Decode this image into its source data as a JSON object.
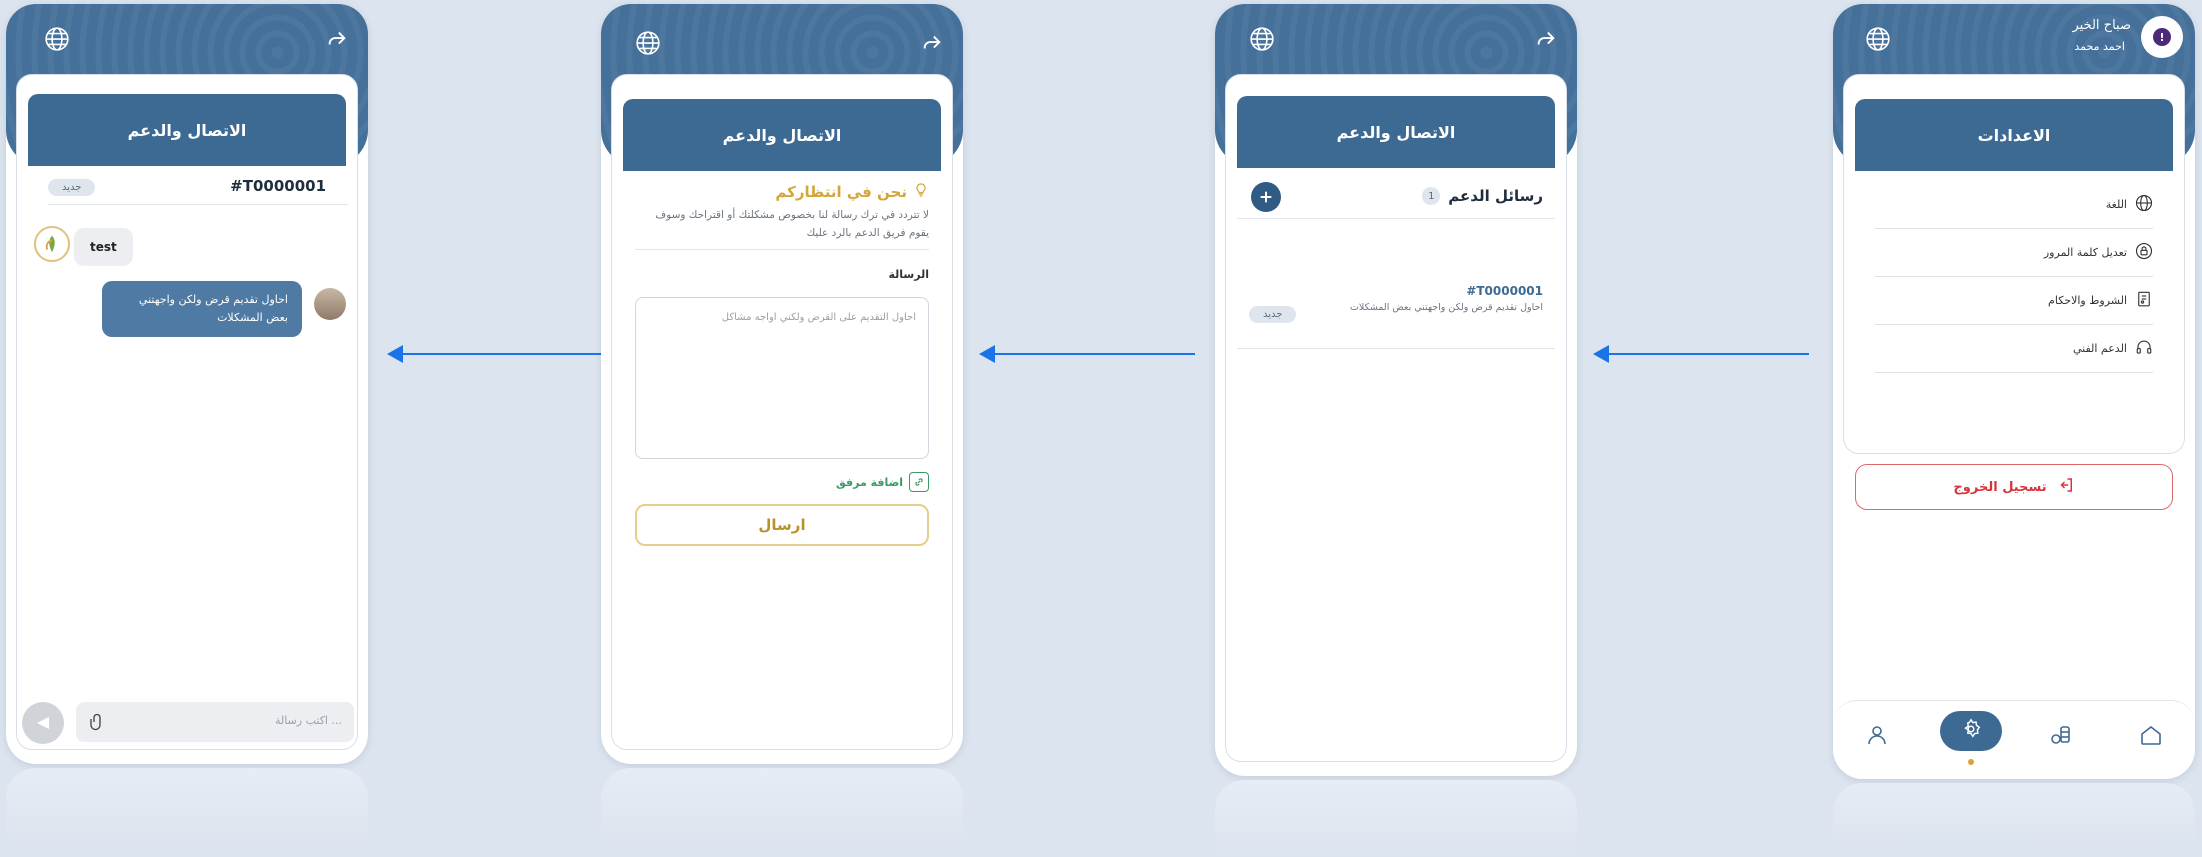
{
  "screens": {
    "settings": {
      "greeting": "صباح الخير",
      "user_name": "احمد محمد",
      "title": "الاعدادات",
      "items": [
        {
          "label": "اللغة",
          "icon": "globe-icon"
        },
        {
          "label": "تعديل كلمة المرور",
          "icon": "lock-icon"
        },
        {
          "label": "الشروط والاحكام",
          "icon": "document-icon"
        },
        {
          "label": "الدعم الفني",
          "icon": "headset-icon"
        }
      ],
      "logout_label": "تسجيل الخروج",
      "nav": [
        "home-icon",
        "coins-icon",
        "settings-icon",
        "user-icon"
      ],
      "accent_logout": "#d9343a"
    },
    "support_list": {
      "title": "الاتصال والدعم",
      "heading": "رسائل الدعم",
      "count": "1",
      "ticket_id": "#T0000001",
      "ticket_preview": "احاول تقديم قرض ولكن واجهتني بعض المشكلات",
      "ticket_status": "جديد"
    },
    "new_message": {
      "title": "الاتصال والدعم",
      "heading": "نحن في انتظاركم",
      "subtitle": "لا تتردد في ترك رسالة لنا بخصوص مشكلتك أو اقتراحك وسوف يقوم فريق الدعم بالرد عليك",
      "field_label": "الرسالة",
      "message_placeholder": "احاول التقديم على القرض ولكني اواجه مشاكل",
      "attach_label": "اضافة مرفق",
      "send_label": "ارسال",
      "accent_gold": "#d4a63a"
    },
    "chat": {
      "title": "الاتصال والدعم",
      "ticket_id": "#T0000001",
      "status": "جديد",
      "message_in": "test",
      "message_out": "احاول تقديم قرض ولكن واجهتني بعض المشكلات",
      "input_placeholder": "اكتب رسالة ..."
    }
  },
  "colors": {
    "primary": "#3d6a93",
    "background": "#dce4ef",
    "arrow": "#1a73e8"
  }
}
